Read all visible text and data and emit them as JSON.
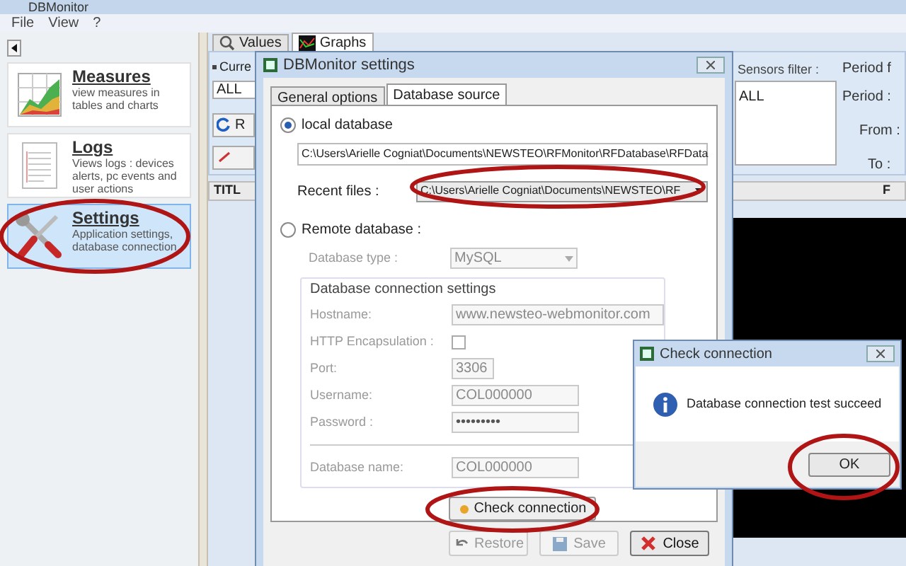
{
  "window": {
    "title": "DBMonitor"
  },
  "menu": [
    "File",
    "View",
    "?"
  ],
  "sidebar": {
    "items": [
      {
        "kind": "chart",
        "title": "Measures",
        "description": "view measures in tables and charts",
        "selected": false
      },
      {
        "kind": "page",
        "title": "Logs",
        "description": "Views logs : devices alerts, pc events and user actions",
        "selected": false
      },
      {
        "kind": "tools",
        "title": "Settings",
        "description": "Application settings, database connection",
        "selected": true
      }
    ]
  },
  "main_tabs": [
    {
      "kind": "search",
      "label": "Values",
      "selected": false
    },
    {
      "kind": "graph",
      "label": "Graphs",
      "selected": true
    }
  ],
  "filters": {
    "current_label": "Curre",
    "current_value": "ALL",
    "refresh_button": "R",
    "sensors_filter_label": "Sensors filter :",
    "sensors": [
      "ALL"
    ],
    "period_group": "Period f",
    "period_label": "Period :",
    "from_label": "From :",
    "to_label": "To :"
  },
  "table": {
    "columns": [
      "TITL",
      "F"
    ]
  },
  "settings_dialog": {
    "title": "DBMonitor settings",
    "tabs": [
      {
        "label": "General options",
        "selected": false
      },
      {
        "label": "Database source",
        "selected": true
      }
    ],
    "local": {
      "label": "local database",
      "selected": true,
      "path": "C:\\Users\\Arielle Cogniat\\Documents\\NEWSTEO\\RFMonitor\\RFDatabase\\RFData",
      "recent_label": "Recent files :",
      "recent_value": "C:\\Users\\Arielle Cogniat\\Documents\\NEWSTEO\\RF"
    },
    "remote": {
      "label": "Remote database :",
      "selected": false,
      "type_label": "Database type :",
      "type_value": "MySQL"
    },
    "connection": {
      "title": "Database connection settings",
      "hostname_label": "Hostname:",
      "hostname": "www.newsteo-webmonitor.com",
      "http_label": "HTTP Encapsulation :",
      "http_checked": false,
      "port_label": "Port:",
      "port": "3306",
      "username_label": "Username:",
      "username": "COL000000",
      "password_label": "Password :",
      "password": "•••••••••",
      "dbname_label": "Database name:",
      "dbname": "COL000000"
    },
    "check_button": "Check connection",
    "buttons": [
      {
        "kind": "restore",
        "label": "Restore",
        "disabled": true
      },
      {
        "kind": "save",
        "label": "Save",
        "disabled": true
      },
      {
        "kind": "close",
        "label": "Close",
        "disabled": false
      }
    ]
  },
  "check_dialog": {
    "title": "Check connection",
    "message": "Database connection test succeed",
    "button": "OK"
  }
}
